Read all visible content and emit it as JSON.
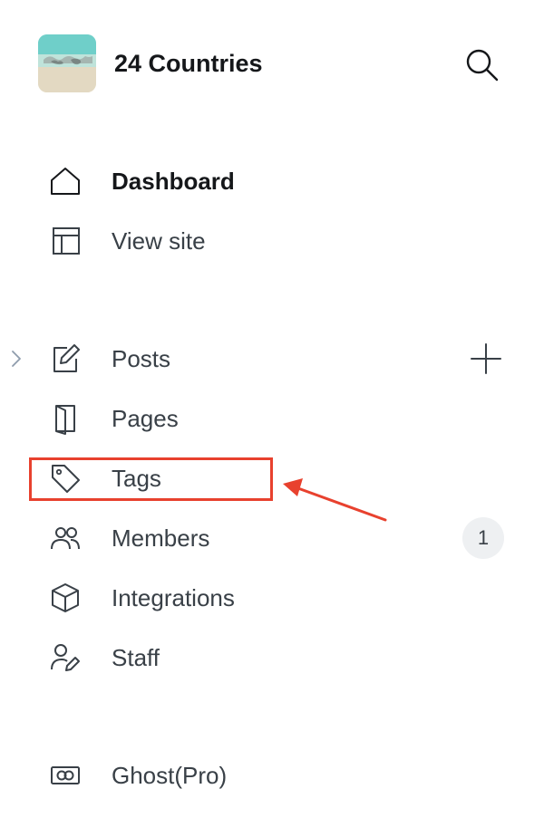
{
  "site": {
    "title": "24 Countries"
  },
  "nav_primary": [
    {
      "label": "Dashboard",
      "icon": "home-icon",
      "active": true
    },
    {
      "label": "View site",
      "icon": "layout-icon",
      "active": false
    }
  ],
  "nav_content": [
    {
      "label": "Posts",
      "icon": "edit-icon"
    },
    {
      "label": "Pages",
      "icon": "pages-icon"
    },
    {
      "label": "Tags",
      "icon": "tag-icon"
    },
    {
      "label": "Members",
      "icon": "members-icon",
      "badge": "1"
    },
    {
      "label": "Integrations",
      "icon": "cube-icon"
    },
    {
      "label": "Staff",
      "icon": "staff-icon"
    }
  ],
  "nav_footer": [
    {
      "label": "Ghost(Pro)",
      "icon": "ghost-pro-icon"
    }
  ],
  "annotation": {
    "highlight_color": "#e8412e",
    "highlighted_item": "Tags"
  },
  "colors": {
    "text_primary": "#15171a",
    "text_secondary": "#394047",
    "badge_bg": "#eef0f2"
  }
}
